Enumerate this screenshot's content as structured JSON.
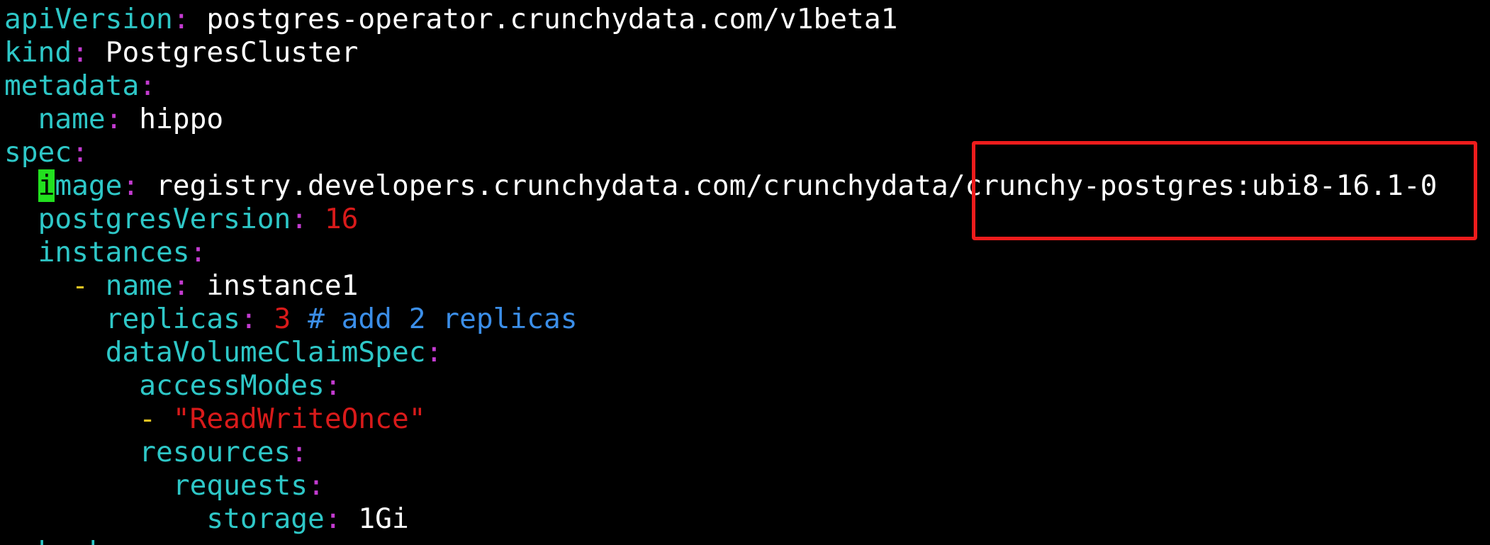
{
  "editor": {
    "lines": [
      {
        "indent": "",
        "dash": "",
        "key": "apiVersion",
        "value": "postgres-operator.crunchydata.com/v1beta1",
        "value_type": "plain"
      },
      {
        "indent": "",
        "dash": "",
        "key": "kind",
        "value": "PostgresCluster",
        "value_type": "plain"
      },
      {
        "indent": "",
        "dash": "",
        "key": "metadata",
        "value": "",
        "value_type": "none"
      },
      {
        "indent": "  ",
        "dash": "",
        "key": "name",
        "value": "hippo",
        "value_type": "plain"
      },
      {
        "indent": "",
        "dash": "",
        "key": "spec",
        "value": "",
        "value_type": "none"
      },
      {
        "indent": "  ",
        "dash": "",
        "key": "image",
        "value": "registry.developers.crunchydata.com/crunchydata/crunchy-postgres:ubi8-16.1-0",
        "value_type": "plain",
        "cursor_char": "i",
        "key_rest": "mage"
      },
      {
        "indent": "  ",
        "dash": "",
        "key": "postgresVersion",
        "value": "16",
        "value_type": "number"
      },
      {
        "indent": "  ",
        "dash": "",
        "key": "instances",
        "value": "",
        "value_type": "none"
      },
      {
        "indent": "    ",
        "dash": "- ",
        "key": "name",
        "value": "instance1",
        "value_type": "plain"
      },
      {
        "indent": "      ",
        "dash": "",
        "key": "replicas",
        "value": "3",
        "value_type": "number",
        "comment": "# add 2 replicas"
      },
      {
        "indent": "      ",
        "dash": "",
        "key": "dataVolumeClaimSpec",
        "value": "",
        "value_type": "none"
      },
      {
        "indent": "        ",
        "dash": "",
        "key": "accessModes",
        "value": "",
        "value_type": "none"
      },
      {
        "indent": "        ",
        "dash": "- ",
        "key": "",
        "value": "\"ReadWriteOnce\"",
        "value_type": "string"
      },
      {
        "indent": "        ",
        "dash": "",
        "key": "resources",
        "value": "",
        "value_type": "none"
      },
      {
        "indent": "          ",
        "dash": "",
        "key": "requests",
        "value": "",
        "value_type": "none"
      },
      {
        "indent": "            ",
        "dash": "",
        "key": "storage",
        "value": "1Gi",
        "value_type": "plain"
      },
      {
        "indent": "  ",
        "dash": "",
        "key": "backups",
        "value": "",
        "value_type": "partial"
      }
    ],
    "cursor": {
      "line": 6,
      "column": 3
    },
    "highlight": {
      "target": "crunchy-postgres:ubi8-16.1-0",
      "color": "#ee1c1c"
    }
  },
  "colors": {
    "background": "#000000",
    "key": "#2ec7c7",
    "punctuation": "#c33bd0",
    "plain_value": "#ffffff",
    "number_string": "#d81a1a",
    "dash": "#e3c322",
    "comment": "#3b8ee8",
    "cursor": "#22e01f"
  }
}
